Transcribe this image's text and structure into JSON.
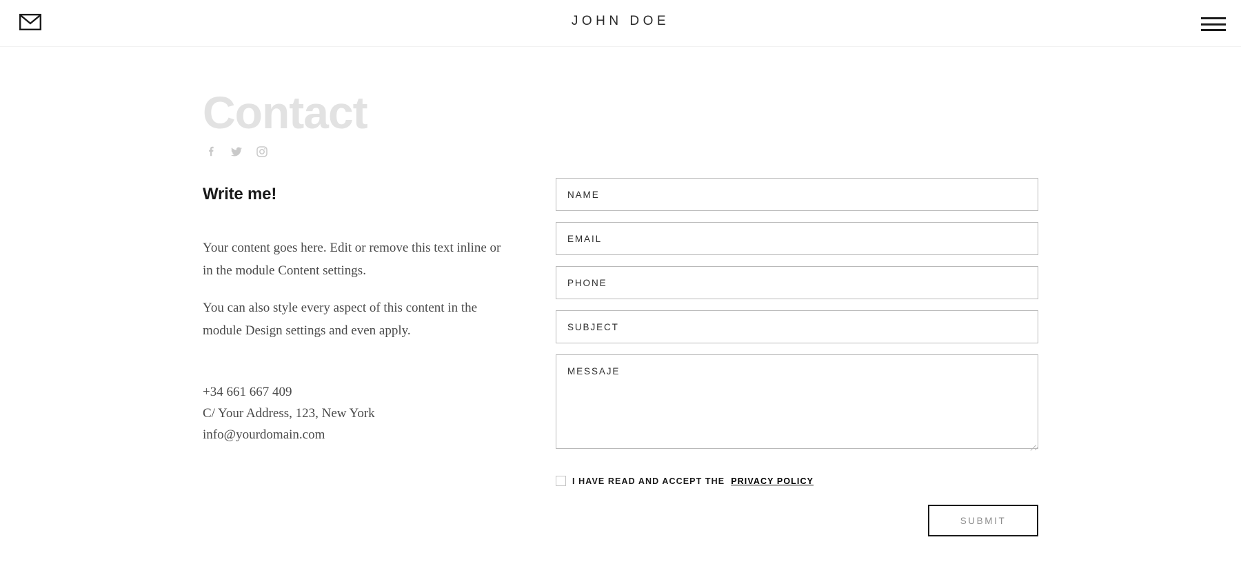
{
  "header": {
    "mail_icon": "mail-icon",
    "brand_title": "JOHN DOE",
    "menu_icon": "hamburger-menu-icon"
  },
  "left": {
    "heading": "Contact",
    "social": [
      {
        "name": "facebook-icon",
        "label": "f"
      },
      {
        "name": "twitter-icon",
        "label": "twitter"
      },
      {
        "name": "instagram-icon",
        "label": "instagram"
      }
    ],
    "subheading": "Write me!",
    "paragraph_1": "Your content goes here. Edit or remove this text inline or in the module Content settings.",
    "paragraph_2": "You can also style every aspect of this content in the module Design settings and even apply.",
    "phone": "+34 661 667 409",
    "address": "C/ Your Address, 123, New York",
    "email": "info@yourdomain.com"
  },
  "form": {
    "name_placeholder": "NAME",
    "name_value": "",
    "email_placeholder": "EMAIL",
    "email_value": "",
    "phone_placeholder": "PHONE",
    "phone_value": "",
    "subject_placeholder": "SUBJECT",
    "subject_value": "",
    "message_placeholder": "MESSAJE",
    "message_value": "",
    "consent_text": "I HAVE READ AND ACCEPT THE",
    "privacy_link": "PRIVACY POLICY",
    "consent_checked": false,
    "submit_label": "SUBMIT"
  },
  "colors": {
    "heading_gray": "#e2e2e2",
    "text_dark": "#1a1a1a",
    "body_gray": "#4a4a4a",
    "border_gray": "#b9b9b9",
    "submit_text": "#8d8d8d"
  }
}
